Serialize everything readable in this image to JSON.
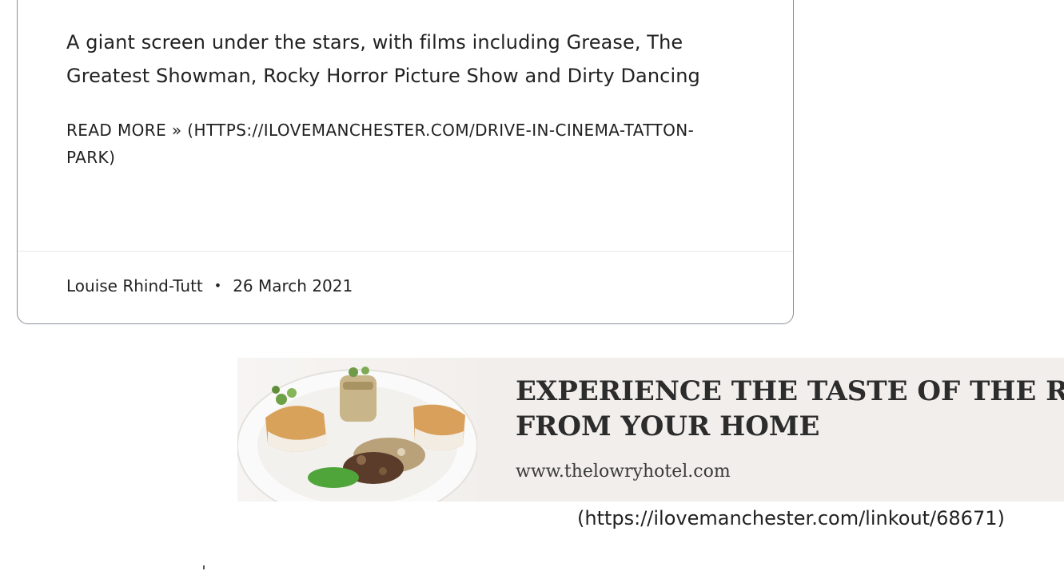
{
  "article_card": {
    "excerpt": "A giant screen under the stars, with films including Grease, The Greatest Showman, Rocky Horror Picture Show and Dirty Dancing",
    "read_more": "READ MORE » (HTTPS://ILOVEMANCHESTER.COM/DRIVE-IN-CINEMA-TATTON-PARK)",
    "author": "Louise Rhind-Tutt",
    "separator": "•",
    "date": "26 March 2021"
  },
  "advert": {
    "headline": "EXPERIENCE THE TASTE OF THE RIVER\nFROM YOUR HOME",
    "url": "www.thelowryhotel.com",
    "link_text": "(https://ilovemanchester.com/linkout/68671)"
  },
  "colors": {
    "card_border": "#8a9099",
    "divider": "#e6e8eb",
    "ad_background": "#f1eeeb",
    "text": "#222222"
  }
}
